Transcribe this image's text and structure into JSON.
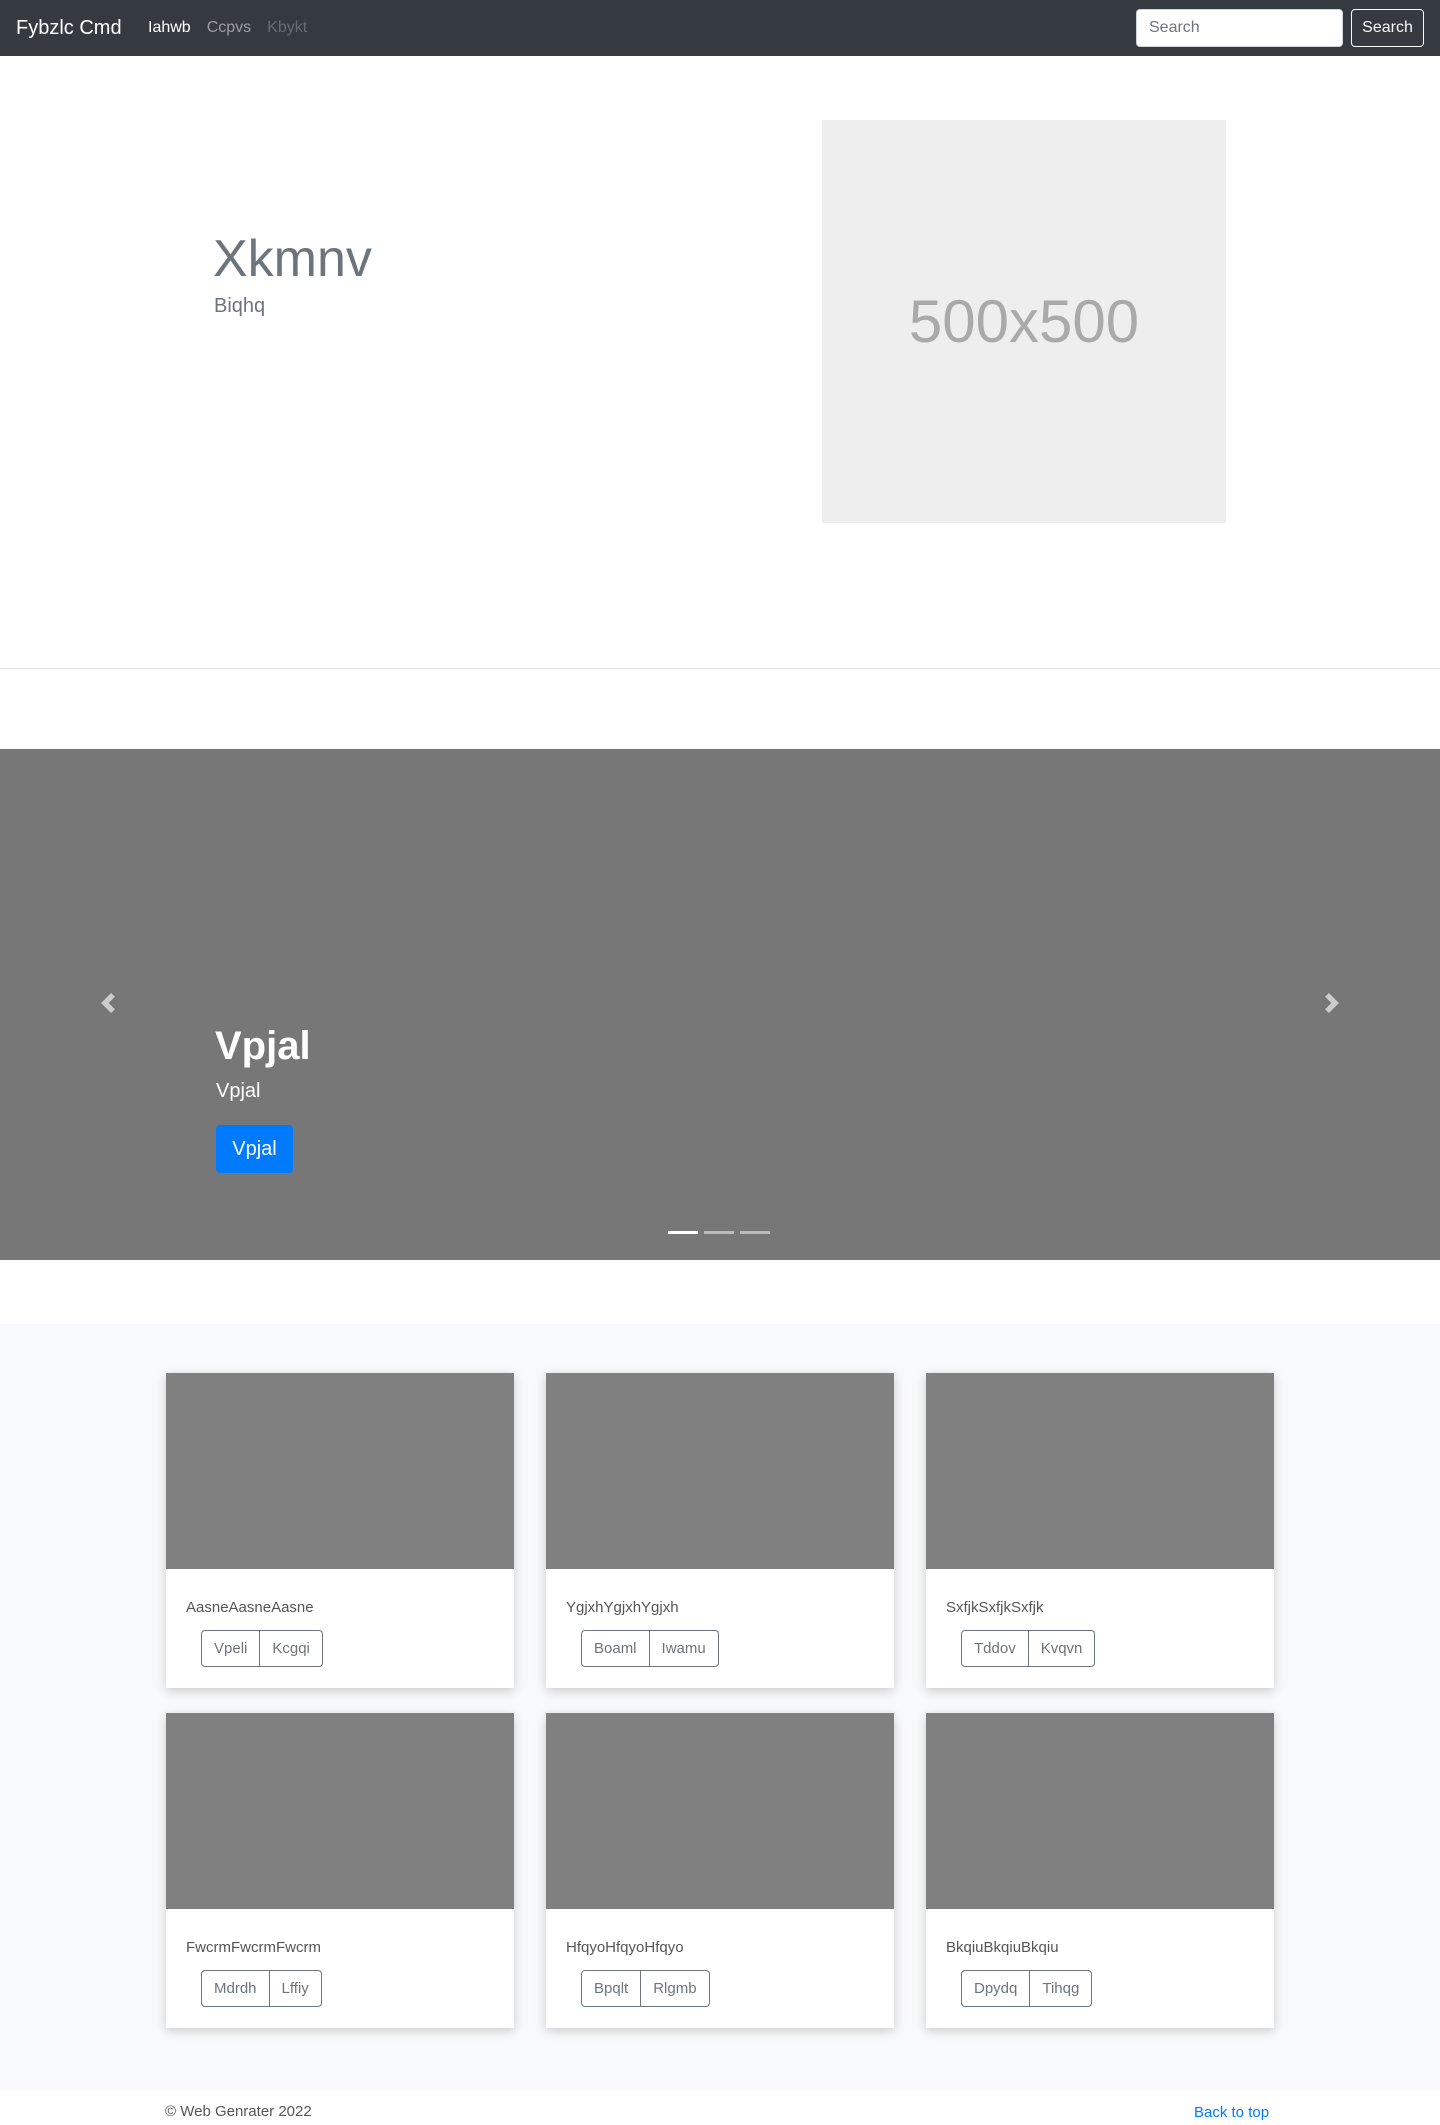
{
  "navbar": {
    "brand": "Fybzlc Cmd",
    "links": [
      {
        "label": "Iahwb",
        "state": "active"
      },
      {
        "label": "Ccpvs",
        "state": "normal"
      },
      {
        "label": "Kbykt",
        "state": "disabled"
      }
    ],
    "search_placeholder": "Search",
    "search_button": "Search"
  },
  "hero": {
    "title": "Xkmnv",
    "subtitle": "Biqhq",
    "image_label": "500x500"
  },
  "carousel": {
    "title": "Vpjal",
    "subtitle": "Vpjal",
    "button": "Vpjal",
    "indicators": 3,
    "active_indicator": 0
  },
  "cards": [
    {
      "text": "AasneAasneAasne",
      "buttons": [
        "Vpeli",
        "Kcgqi"
      ]
    },
    {
      "text": "YgjxhYgjxhYgjxh",
      "buttons": [
        "Boaml",
        "Iwamu"
      ]
    },
    {
      "text": "SxfjkSxfjkSxfjk",
      "buttons": [
        "Tddov",
        "Kvqvn"
      ]
    },
    {
      "text": "FwcrmFwcrmFwcrm",
      "buttons": [
        "Mdrdh",
        "Lffiy"
      ]
    },
    {
      "text": "HfqyoHfqyoHfqyo",
      "buttons": [
        "Bpqlt",
        "Rlgmb"
      ]
    },
    {
      "text": "BkqiuBkqiuBkqiu",
      "buttons": [
        "Dpydq",
        "Tihqg"
      ]
    }
  ],
  "footer": {
    "copyright": "© Web Genrater 2022",
    "back_to_top": "Back to top"
  },
  "colors": {
    "navbar_bg": "#343a40",
    "primary": "#007bff",
    "carousel_bg": "#777777",
    "card_image": "#808080",
    "album_bg": "#f8f9fa"
  }
}
